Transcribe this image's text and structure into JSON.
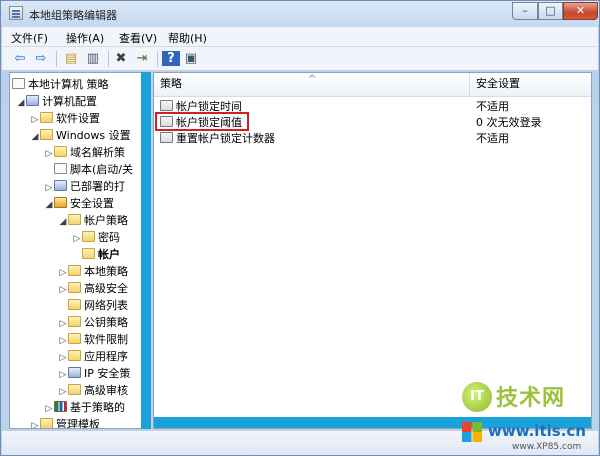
{
  "window": {
    "title": "本地组策略编辑器"
  },
  "menu": [
    "文件(F)",
    "操作(A)",
    "查看(V)",
    "帮助(H)"
  ],
  "toolbar": [
    "back-arrow-icon",
    "forward-arrow-icon",
    "up-folder-icon",
    "show-tree-icon",
    "delete-icon",
    "export-icon",
    "help-icon",
    "properties-icon"
  ],
  "tree": {
    "root": "本地计算机 策略",
    "computer_config": "计算机配置",
    "software_settings": "软件设置",
    "windows_settings": "Windows 设置",
    "dns": "域名解析策",
    "scripts": "脚本(启动/关",
    "printers": "已部署的打",
    "security_settings": "安全设置",
    "account_policies": "帐户策略",
    "password": "密码",
    "account_lockout": "帐户",
    "local_policies": "本地策略",
    "advanced_security": "高级安全",
    "network_list": "网络列表",
    "public_key": "公钥策略",
    "software_restriction": "软件限制",
    "app_control": "应用程序",
    "ip_security": "IP 安全策",
    "advanced_audit": "高级审核",
    "qos": "基于策略的",
    "admin_templates": "管理模板"
  },
  "table": {
    "col_policy": "策略",
    "col_setting": "安全设置",
    "rows": [
      {
        "name": "帐户锁定时间",
        "value": "不适用"
      },
      {
        "name": "帐户锁定阈值",
        "value": "0 次无效登录"
      },
      {
        "name": "重置帐户锁定计数器",
        "value": "不适用"
      }
    ]
  },
  "watermark": {
    "title": "技术网",
    "url": "www.itis.cn",
    "sub": "www.XP85.com",
    "badge": "IT"
  },
  "colors": {
    "highlight": "#d21f1f",
    "accent": "#18a2d9"
  }
}
